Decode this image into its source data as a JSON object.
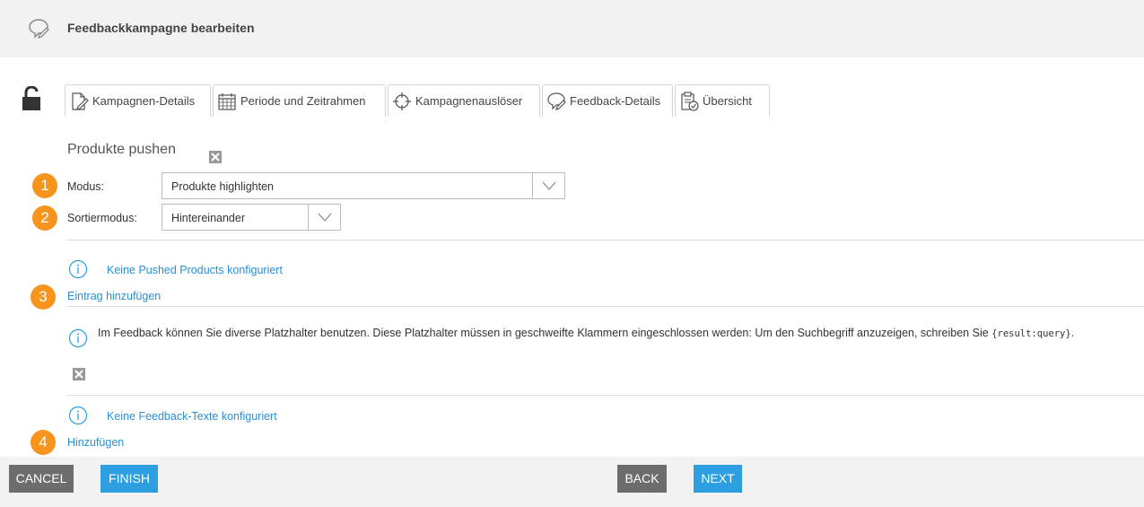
{
  "header": {
    "title": "Feedbackkampagne bearbeiten",
    "icon": "speech-bubble-pen-icon"
  },
  "tabs": [
    {
      "label": "Kampagnen-Details",
      "icon": "document-edit-icon"
    },
    {
      "label": "Periode und Zeitrahmen",
      "icon": "calendar-icon"
    },
    {
      "label": "Kampagnenauslöser",
      "icon": "crosshair-icon"
    },
    {
      "label": "Feedback-Details",
      "icon": "speech-bubble-pen-icon",
      "active": true
    },
    {
      "label": "Übersicht",
      "icon": "clipboard-check-icon"
    }
  ],
  "section": {
    "title": "Produkte pushen"
  },
  "badges": [
    "1",
    "2",
    "3",
    "4"
  ],
  "form": {
    "modus_label": "Modus:",
    "modus_value": "Produkte highlighten",
    "sort_label": "Sortiermodus:",
    "sort_value": "Hintereinander"
  },
  "pushed": {
    "empty_text": "Keine Pushed Products konfiguriert",
    "add_link": "Eintrag hinzufügen"
  },
  "feedback": {
    "info_text": "Im Feedback können Sie diverse Platzhalter benutzen. Diese Platzhalter müssen in geschweifte Klammern eingeschlossen werden: Um den Suchbegriff anzuzeigen, schreiben Sie",
    "info_code": "{result:query}",
    "info_end": ".",
    "empty_text": "Keine Feedback-Texte konfiguriert",
    "add_link": "Hinzufügen"
  },
  "footer": {
    "cancel": "CANCEL",
    "finish": "FINISH",
    "back": "BACK",
    "next": "NEXT"
  },
  "colors": {
    "accent": "#2d9ee0",
    "badge": "#f7941d",
    "gray_button": "#6d6d6d",
    "link": "#2a8fd6"
  }
}
